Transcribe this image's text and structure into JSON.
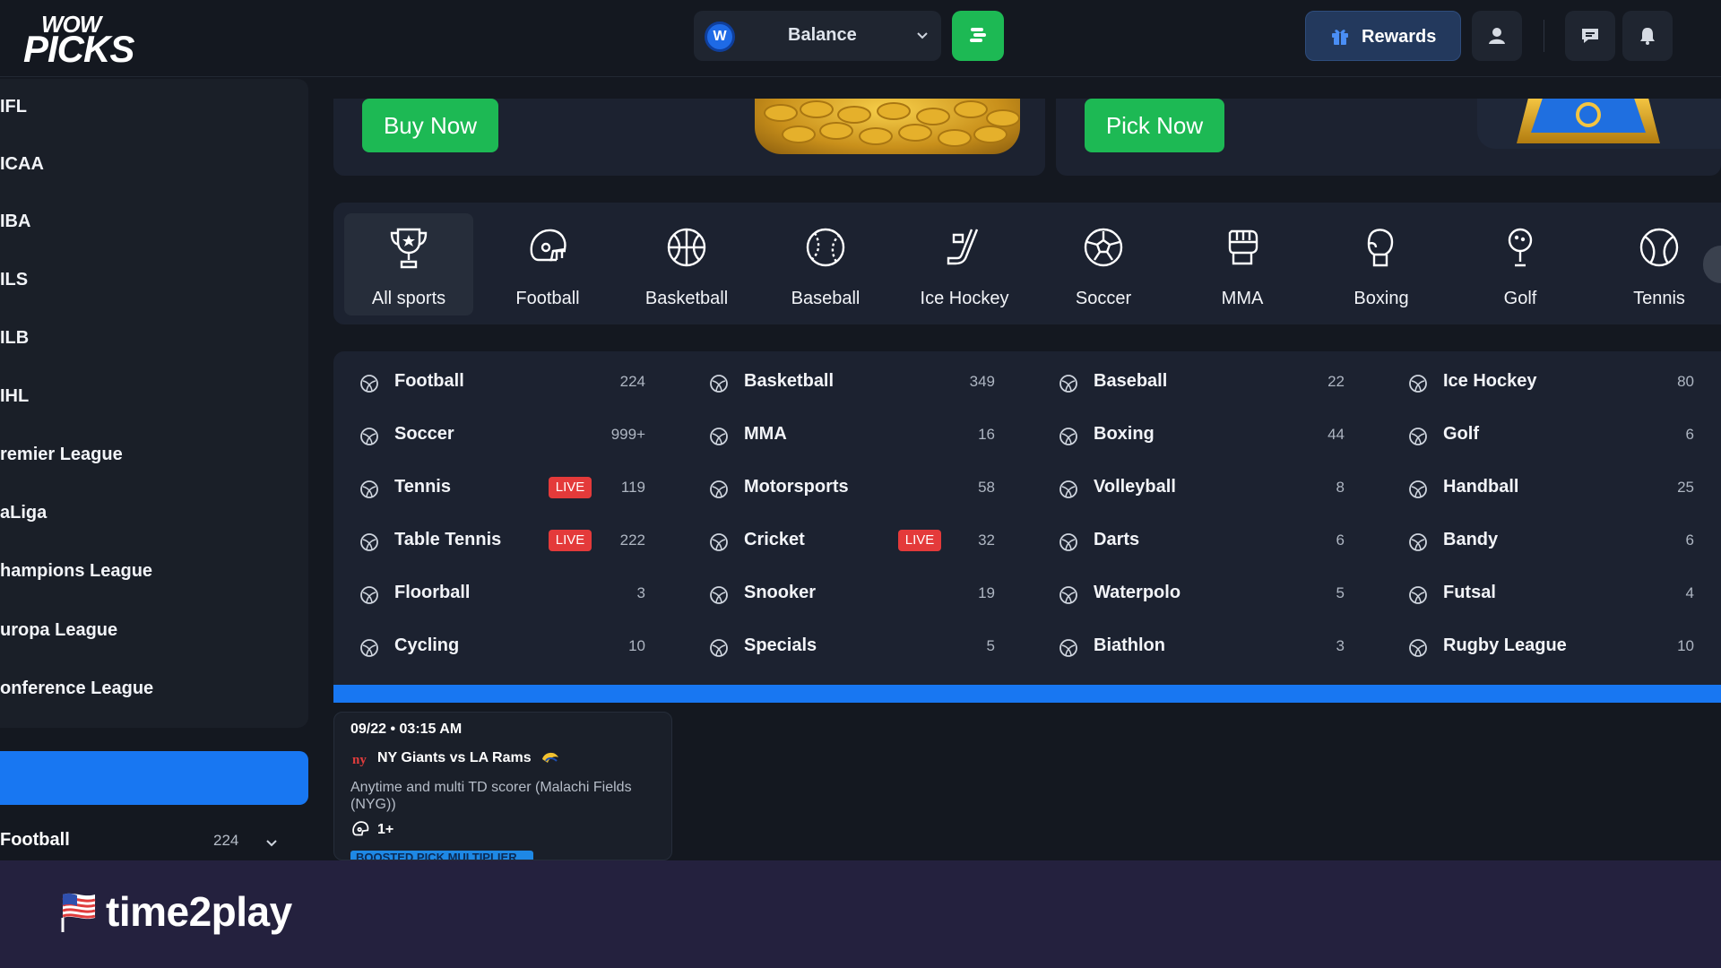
{
  "header": {
    "logo_top": "WOW",
    "logo_bottom": "PICKS",
    "balance_label": "Balance",
    "balance_coin": "W",
    "rewards_label": "Rewards"
  },
  "sidebar": {
    "items": [
      {
        "label": "IFL"
      },
      {
        "label": "ICAA"
      },
      {
        "label": "IBA"
      },
      {
        "label": "ILS"
      },
      {
        "label": "ILB"
      },
      {
        "label": "IHL"
      },
      {
        "label": "remier League"
      },
      {
        "label": "aLiga"
      },
      {
        "label": "hampions League"
      },
      {
        "label": "uropa League"
      },
      {
        "label": "onference League"
      }
    ],
    "footer_sport": "Football",
    "footer_count": "224"
  },
  "banners": {
    "buy_now": "Buy Now",
    "pick_now": "Pick Now"
  },
  "tabs": [
    {
      "label": "All sports",
      "icon": "trophy-icon"
    },
    {
      "label": "Football",
      "icon": "football-helmet-icon"
    },
    {
      "label": "Basketball",
      "icon": "basketball-icon"
    },
    {
      "label": "Baseball",
      "icon": "baseball-icon"
    },
    {
      "label": "Ice Hockey",
      "icon": "hockey-stick-icon"
    },
    {
      "label": "Soccer",
      "icon": "soccer-ball-icon"
    },
    {
      "label": "MMA",
      "icon": "mma-glove-icon"
    },
    {
      "label": "Boxing",
      "icon": "boxing-glove-icon"
    },
    {
      "label": "Golf",
      "icon": "golf-icon"
    },
    {
      "label": "Tennis",
      "icon": "tennis-ball-icon"
    }
  ],
  "sports_grid": [
    [
      {
        "name": "Football",
        "count": "224",
        "live": false,
        "icon": "football-helmet-icon"
      },
      {
        "name": "Soccer",
        "count": "999+",
        "live": false,
        "icon": "soccer-ball-icon"
      },
      {
        "name": "Tennis",
        "count": "119",
        "live": true,
        "icon": "tennis-ball-icon"
      },
      {
        "name": "Table Tennis",
        "count": "222",
        "live": true,
        "icon": "table-tennis-icon"
      },
      {
        "name": "Floorball",
        "count": "3",
        "live": false,
        "icon": "floorball-icon"
      },
      {
        "name": "Cycling",
        "count": "10",
        "live": false,
        "icon": "cycling-icon"
      }
    ],
    [
      {
        "name": "Basketball",
        "count": "349",
        "live": false,
        "icon": "basketball-icon"
      },
      {
        "name": "MMA",
        "count": "16",
        "live": false,
        "icon": "mma-glove-icon"
      },
      {
        "name": "Motorsports",
        "count": "58",
        "live": false,
        "icon": "motorsports-icon"
      },
      {
        "name": "Cricket",
        "count": "32",
        "live": true,
        "icon": "cricket-icon"
      },
      {
        "name": "Snooker",
        "count": "19",
        "live": false,
        "icon": "snooker-icon"
      },
      {
        "name": "Specials",
        "count": "5",
        "live": false,
        "icon": "specials-icon"
      }
    ],
    [
      {
        "name": "Baseball",
        "count": "22",
        "live": false,
        "icon": "baseball-icon"
      },
      {
        "name": "Boxing",
        "count": "44",
        "live": false,
        "icon": "boxing-glove-icon"
      },
      {
        "name": "Volleyball",
        "count": "8",
        "live": false,
        "icon": "volleyball-icon"
      },
      {
        "name": "Darts",
        "count": "6",
        "live": false,
        "icon": "darts-icon"
      },
      {
        "name": "Waterpolo",
        "count": "5",
        "live": false,
        "icon": "waterpolo-icon"
      },
      {
        "name": "Biathlon",
        "count": "3",
        "live": false,
        "icon": "biathlon-icon"
      }
    ],
    [
      {
        "name": "Ice Hockey",
        "count": "80",
        "live": false,
        "icon": "hockey-stick-icon"
      },
      {
        "name": "Golf",
        "count": "6",
        "live": false,
        "icon": "golf-icon"
      },
      {
        "name": "Handball",
        "count": "25",
        "live": false,
        "icon": "handball-icon"
      },
      {
        "name": "Bandy",
        "count": "6",
        "live": false,
        "icon": "bandy-icon"
      },
      {
        "name": "Futsal",
        "count": "4",
        "live": false,
        "icon": "futsal-icon"
      },
      {
        "name": "Rugby League",
        "count": "10",
        "live": false,
        "icon": "rugby-icon"
      }
    ]
  ],
  "live_label": "LIVE",
  "pick_card": {
    "date": "09/22 • 03:15 AM",
    "match": "NY Giants vs LA Rams",
    "description": "Anytime and multi TD scorer (Malachi Fields (NYG))",
    "multiplier": "1+",
    "boost_label": "BOOSTED PICK MULTIPLIER"
  },
  "watermark": {
    "brand": "time2play"
  },
  "colors": {
    "accent_green": "#1db954",
    "accent_blue": "#1877f2",
    "live_red": "#e43a3a"
  }
}
